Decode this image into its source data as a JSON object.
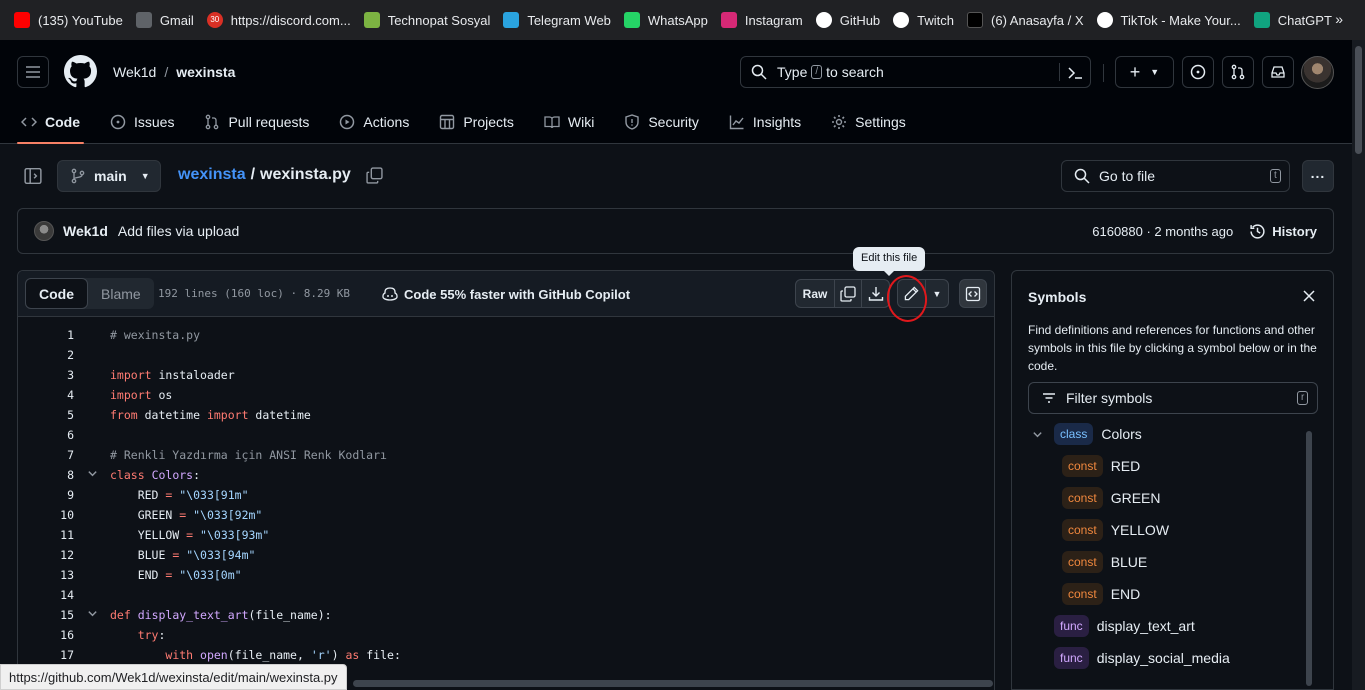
{
  "bookmarks": [
    {
      "label": "(135) YouTube",
      "icon": "youtube-icon",
      "color": "#ff0000"
    },
    {
      "label": "Gmail",
      "icon": "gmail-icon",
      "color": "#5f6368"
    },
    {
      "label": "https://discord.com...",
      "icon": "discord-icon",
      "color": "#d93025"
    },
    {
      "label": "Technopat Sosyal",
      "icon": "technopat-icon",
      "color": "#7cb342"
    },
    {
      "label": "Telegram Web",
      "icon": "telegram-icon",
      "color": "#2aa3df"
    },
    {
      "label": "WhatsApp",
      "icon": "whatsapp-icon",
      "color": "#25d366"
    },
    {
      "label": "Instagram",
      "icon": "instagram-icon",
      "color": "#d62976"
    },
    {
      "label": "GitHub",
      "icon": "github-icon",
      "color": "#ffffff"
    },
    {
      "label": "Twitch",
      "icon": "twitch-icon",
      "color": "#ffffff"
    },
    {
      "label": "(6) Anasayfa / X",
      "icon": "x-icon",
      "color": "#000000"
    },
    {
      "label": "TikTok - Make Your...",
      "icon": "tiktok-icon",
      "color": "#ffffff"
    },
    {
      "label": "ChatGPT",
      "icon": "chatgpt-icon",
      "color": "#10a37f"
    }
  ],
  "bookmarks_more": "»",
  "discord_badge": "30",
  "header": {
    "owner": "Wek1d",
    "separator": "/",
    "repo": "wexinsta",
    "search_prefix": "Type",
    "search_key": "/",
    "search_suffix": "to search"
  },
  "nav_tabs": [
    {
      "label": "Code",
      "icon": "code-icon",
      "selected": true
    },
    {
      "label": "Issues",
      "icon": "issue-icon"
    },
    {
      "label": "Pull requests",
      "icon": "pull-request-icon"
    },
    {
      "label": "Actions",
      "icon": "actions-icon"
    },
    {
      "label": "Projects",
      "icon": "projects-icon"
    },
    {
      "label": "Wiki",
      "icon": "wiki-icon"
    },
    {
      "label": "Security",
      "icon": "shield-icon"
    },
    {
      "label": "Insights",
      "icon": "graph-icon"
    },
    {
      "label": "Settings",
      "icon": "gear-icon"
    }
  ],
  "file": {
    "branch": "main",
    "repo_link": "wexinsta",
    "sep": "/",
    "filename": "wexinsta.py",
    "goto_file": "Go to file",
    "goto_key": "t"
  },
  "commit": {
    "author": "Wek1d",
    "message": "Add files via upload",
    "sha_time": "6160880 · 2 months ago",
    "history": "History"
  },
  "code_header": {
    "tab_code": "Code",
    "tab_blame": "Blame",
    "info": "192 lines (160 loc) · 8.29 KB",
    "copilot": "Code 55% faster with GitHub Copilot",
    "raw": "Raw"
  },
  "tooltip": "Edit this file",
  "code_lines": [
    {
      "n": "1",
      "html": "<span class='cm'># wexinsta.py</span>"
    },
    {
      "n": "2",
      "html": ""
    },
    {
      "n": "3",
      "html": "<span class='kw'>import</span> instaloader"
    },
    {
      "n": "4",
      "html": "<span class='kw'>import</span> os"
    },
    {
      "n": "5",
      "html": "<span class='kw'>from</span> datetime <span class='kw'>import</span> datetime"
    },
    {
      "n": "6",
      "html": ""
    },
    {
      "n": "7",
      "html": "<span class='cm'># Renkli Yazdırma için ANSI Renk Kodları</span>"
    },
    {
      "n": "8",
      "html": "<span class='kw'>class</span> <span class='fn'>Colors</span>:",
      "fold": true
    },
    {
      "n": "9",
      "html": "    RED <span class='kw'>=</span> <span class='str'>\"\\033[91m\"</span>"
    },
    {
      "n": "10",
      "html": "    GREEN <span class='kw'>=</span> <span class='str'>\"\\033[92m\"</span>"
    },
    {
      "n": "11",
      "html": "    YELLOW <span class='kw'>=</span> <span class='str'>\"\\033[93m\"</span>"
    },
    {
      "n": "12",
      "html": "    BLUE <span class='kw'>=</span> <span class='str'>\"\\033[94m\"</span>"
    },
    {
      "n": "13",
      "html": "    END <span class='kw'>=</span> <span class='str'>\"\\033[0m\"</span>"
    },
    {
      "n": "14",
      "html": ""
    },
    {
      "n": "15",
      "html": "<span class='kw'>def</span> <span class='fn'>display_text_art</span>(file_name):",
      "fold": true
    },
    {
      "n": "16",
      "html": "    <span class='kw'>try</span>:"
    },
    {
      "n": "17",
      "html": "        <span class='kw'>with</span> <span class='fn'>open</span>(file_name, <span class='str'>'r'</span>) <span class='kw'>as</span> file:"
    }
  ],
  "symbols": {
    "title": "Symbols",
    "desc": "Find definitions and references for functions and other symbols in this file by clicking a symbol below or in the code.",
    "filter": "Filter symbols",
    "filter_key": "r",
    "items": [
      {
        "kind": "class",
        "name": "Colors",
        "level": 0,
        "fold": true
      },
      {
        "kind": "const",
        "name": "RED",
        "level": 1
      },
      {
        "kind": "const",
        "name": "GREEN",
        "level": 1
      },
      {
        "kind": "const",
        "name": "YELLOW",
        "level": 1
      },
      {
        "kind": "const",
        "name": "BLUE",
        "level": 1
      },
      {
        "kind": "const",
        "name": "END",
        "level": 1
      },
      {
        "kind": "func",
        "name": "display_text_art",
        "level": 0
      },
      {
        "kind": "func",
        "name": "display_social_media",
        "level": 0
      }
    ]
  },
  "status_url": "https://github.com/Wek1d/wexinsta/edit/main/wexinsta.py"
}
